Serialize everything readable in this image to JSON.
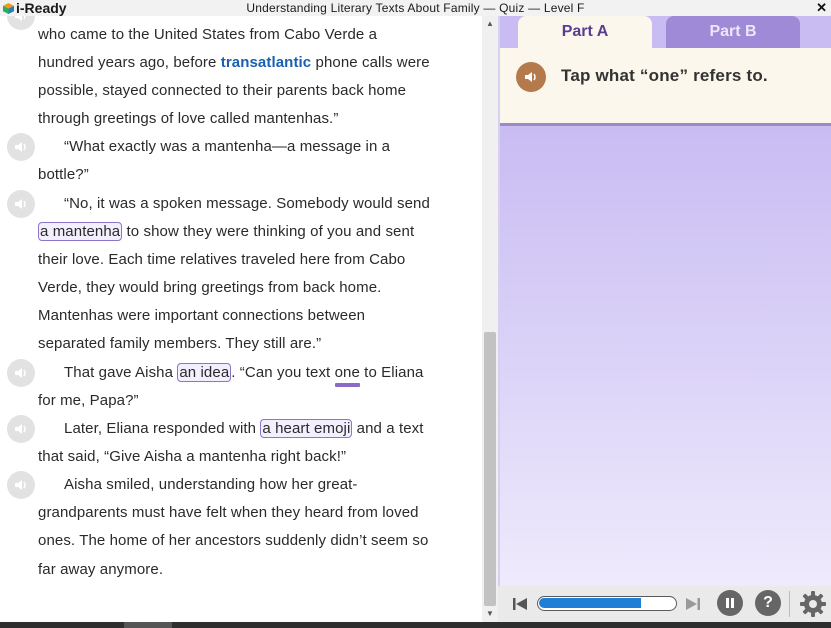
{
  "app": {
    "logo_text": "i-Ready",
    "window_title": "Understanding Literary Texts About Family — Quiz — Level F",
    "close_glyph": "✕"
  },
  "passage": {
    "lines": {
      "l1": "who came to the United States from Cabo Verde a",
      "l2": "hundred years ago, before",
      "l2_vocab": "transatlantic",
      "l2_tail": " phone calls were",
      "l3": "possible, stayed connected to their parents back home",
      "l4": "through greetings of love called mantenhas.”",
      "l5": "“What exactly was a mantenha—a message in a",
      "l6": "bottle?”",
      "l7": "“No, it was a spoken message. Somebody would send",
      "l8_choice": "a mantenha",
      "l8_tail": " to show they were thinking of you and sent",
      "l9": "their love. Each time relatives traveled here from Cabo",
      "l10": "Verde, they would bring greetings from back home.",
      "l11": "Mantenhas were important connections between",
      "l12": "separated family members. They still are.”",
      "l13_head": "That gave Aisha ",
      "l13_choice": "an idea",
      "l13_mid": ". “Can you text ",
      "l13_target": "one",
      "l13_tail": " to Eliana",
      "l14": "for me, Papa?”",
      "l15_head": "Later, Eliana responded with ",
      "l15_choice": "a heart emoji",
      "l15_tail": " and a text",
      "l16": "that said, “Give Aisha a mantenha right back!”",
      "l17": "Aisha smiled, understanding how her great-",
      "l18": "grandparents must have felt when they heard from loved",
      "l19": "ones. The home of her ancestors suddenly didn’t seem so",
      "l20": "far away anymore."
    }
  },
  "question": {
    "tabs": [
      {
        "label": "Part A",
        "selected": true
      },
      {
        "label": "Part B",
        "selected": false
      }
    ],
    "prompt": "Tap what “one” refers to."
  },
  "controls": {
    "progress_fraction": 0.75,
    "help_glyph": "?"
  },
  "colors": {
    "accent_purple": "#8a6cc7",
    "vocab_blue": "#1a5fb4",
    "progress_blue": "#1f7ed6",
    "prompt_audio_brown": "#b57a4c"
  },
  "icons": [
    "speaker-icon",
    "prev-icon",
    "next-icon",
    "pause-icon",
    "help-icon",
    "gear-icon",
    "close-icon",
    "ready-logo-icon"
  ]
}
